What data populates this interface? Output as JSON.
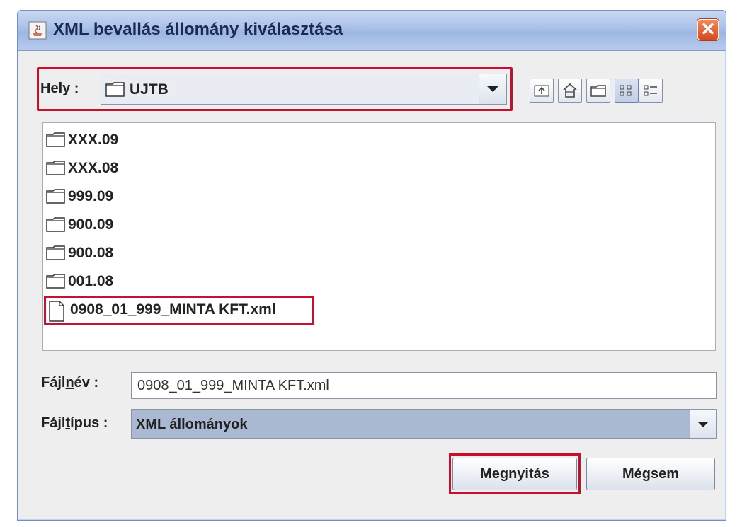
{
  "window": {
    "title": "XML bevallás állomány kiválasztása",
    "close_glyph": "✕"
  },
  "look_in": {
    "label": "Hely :",
    "current_folder": "UJTB"
  },
  "toolbar": {
    "buttons": [
      "up-folder-icon",
      "home-icon",
      "new-folder-icon",
      "list-view-icon",
      "details-view-icon"
    ],
    "selected": "list-view-icon"
  },
  "files": [
    {
      "name": "XXX.09",
      "type": "folder"
    },
    {
      "name": "XXX.08",
      "type": "folder"
    },
    {
      "name": "999.09",
      "type": "folder"
    },
    {
      "name": "900.09",
      "type": "folder"
    },
    {
      "name": "900.08",
      "type": "folder"
    },
    {
      "name": "001.08",
      "type": "folder"
    },
    {
      "name": "0908_01_999_MINTA KFT.xml",
      "type": "file",
      "highlighted": true
    }
  ],
  "filename": {
    "label_pre": "Fájl",
    "label_u": "n",
    "label_post": "év :",
    "value": "0908_01_999_MINTA KFT.xml"
  },
  "filetype": {
    "label_pre": "Fájl",
    "label_u": "t",
    "label_post": "ípus :",
    "value": "XML állományok"
  },
  "buttons": {
    "open": "Megnyitás",
    "cancel": "Mégsem"
  },
  "colors": {
    "highlight": "#c8102e",
    "selected_combo": "#aab8d2"
  }
}
